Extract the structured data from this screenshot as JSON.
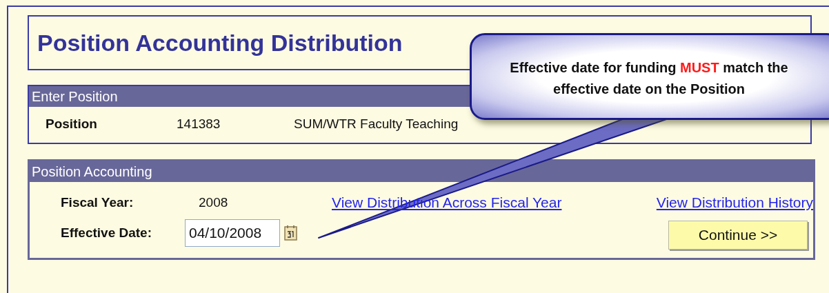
{
  "page_title": "Position Accounting Distribution",
  "enter_position": {
    "header": "Enter Position",
    "label": "Position",
    "number": "141383",
    "description": "SUM/WTR Faculty Teaching"
  },
  "position_accounting": {
    "header": "Position Accounting",
    "fiscal_year_label": "Fiscal Year:",
    "fiscal_year": "2008",
    "effective_date_label": "Effective Date:",
    "effective_date": "04/10/2008",
    "links": [
      "View Distribution Across Fiscal Year",
      "View Distribution History"
    ],
    "button": "Continue >>"
  },
  "callout": {
    "parts": [
      {
        "text": "Effective date for funding ",
        "emphasis": false
      },
      {
        "text": "MUST",
        "emphasis": true
      },
      {
        "text": " match the effective date on the Position",
        "emphasis": false
      }
    ]
  }
}
